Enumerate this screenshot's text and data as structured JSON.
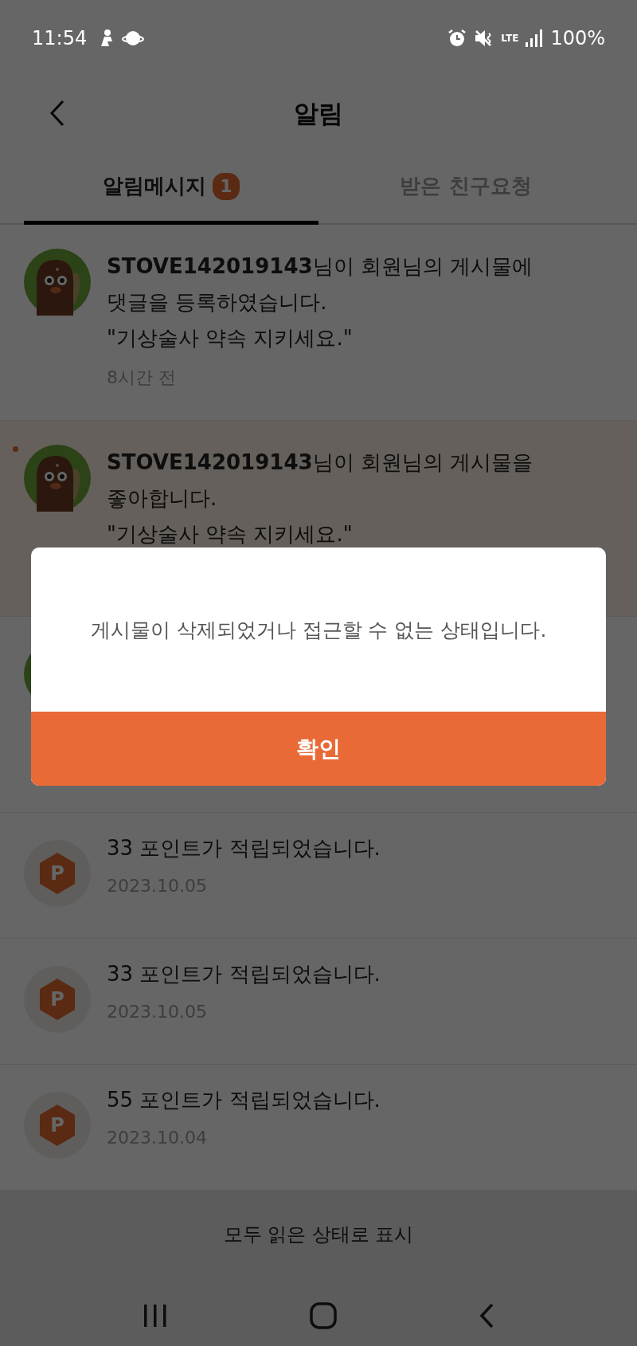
{
  "status_bar": {
    "time": "11:54",
    "network": "LTE",
    "battery": "100%"
  },
  "header": {
    "title": "알림"
  },
  "tabs": [
    {
      "label": "알림메시지",
      "badge": "1",
      "selected": true
    },
    {
      "label": "받은 친구요청",
      "selected": false
    }
  ],
  "notifications": [
    {
      "kind": "user",
      "unread": false,
      "message": "**STOVE142019143**님이 회원님의 게시물에\n댓글을 등록하였습니다.",
      "quote": "\"기상술사 약속 지키세요.\"",
      "time": "8시간 전"
    },
    {
      "kind": "user",
      "unread": true,
      "message": "**STOVE142019143**님이 회원님의 게시물을\n좋아합니다.",
      "quote": "\"기상술사 약속 지키세요.\""
    },
    {
      "kind": "user",
      "unread": false
    },
    {
      "kind": "point",
      "icon_letter": "P",
      "unread": false,
      "message": "33 포인트가 적립되었습니다.",
      "time": "2023.10.05"
    },
    {
      "kind": "point",
      "icon_letter": "P",
      "unread": false,
      "message": "33 포인트가 적립되었습니다.",
      "time": "2023.10.05"
    },
    {
      "kind": "point",
      "icon_letter": "P",
      "unread": false,
      "message": "55 포인트가 적립되었습니다.",
      "time": "2023.10.04"
    }
  ],
  "mark_all_button": "모두 읽은 상태로 표시",
  "dialog": {
    "message": "게시물이 삭제되었거나 접근할 수 없는 상태입니다.",
    "confirm": "확인"
  }
}
